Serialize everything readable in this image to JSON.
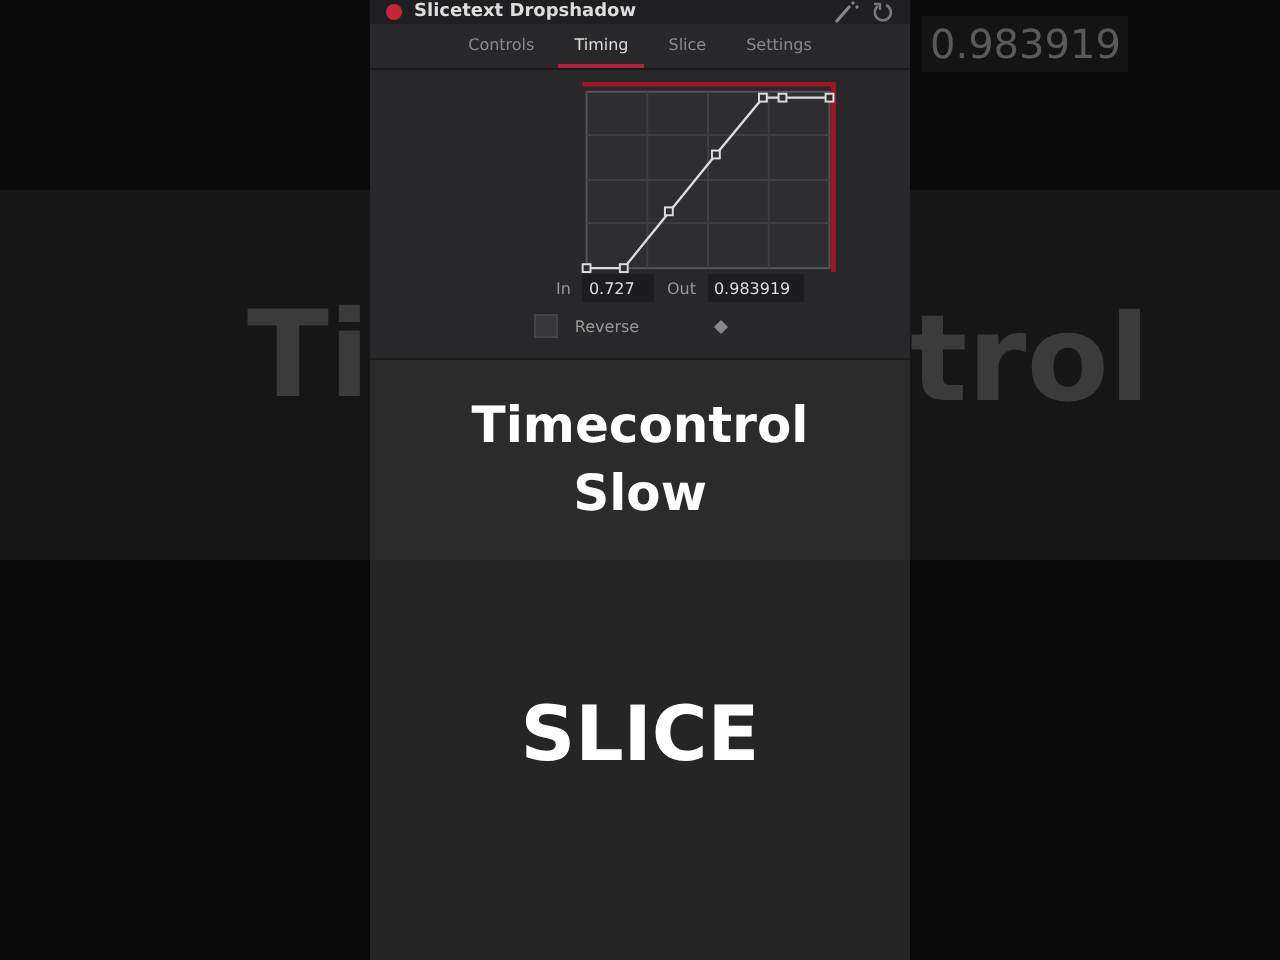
{
  "background": {
    "left_text": "Ti",
    "right_text": "trol",
    "top_value": "0.983919"
  },
  "panel": {
    "title": "Slicetext Dropshadow",
    "tabs": [
      {
        "label": "Controls",
        "selected": false
      },
      {
        "label": "Timing",
        "selected": true
      },
      {
        "label": "Slice",
        "selected": false
      },
      {
        "label": "Settings",
        "selected": false
      }
    ],
    "in": {
      "label": "In",
      "value": "0.727"
    },
    "out": {
      "label": "Out",
      "value": "0.983919"
    },
    "reverse": {
      "label": "Reverse",
      "checked": false
    }
  },
  "captions": [
    "Timecontrol Slow",
    "SLICE"
  ]
}
